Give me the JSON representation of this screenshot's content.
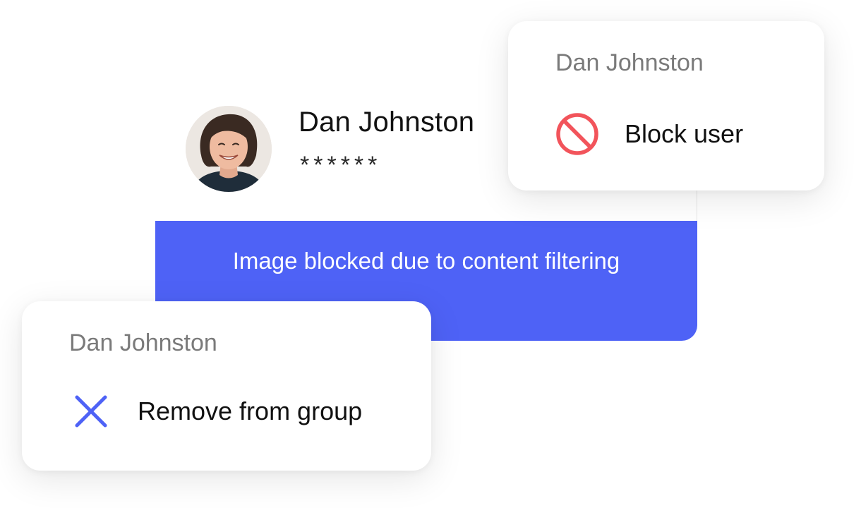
{
  "message": {
    "sender_name": "Dan Johnston",
    "masked_text": "******",
    "blocked_notice": "Image blocked due to content filtering",
    "banner_color": "#4e62f6"
  },
  "block_popup": {
    "title": "Dan Johnston",
    "action_label": "Block user",
    "action_icon": "block-icon",
    "icon_color": "#f2545b"
  },
  "remove_popup": {
    "title": "Dan Johnston",
    "action_label": "Remove from group",
    "action_icon": "close-icon",
    "icon_color": "#4e62f6"
  }
}
